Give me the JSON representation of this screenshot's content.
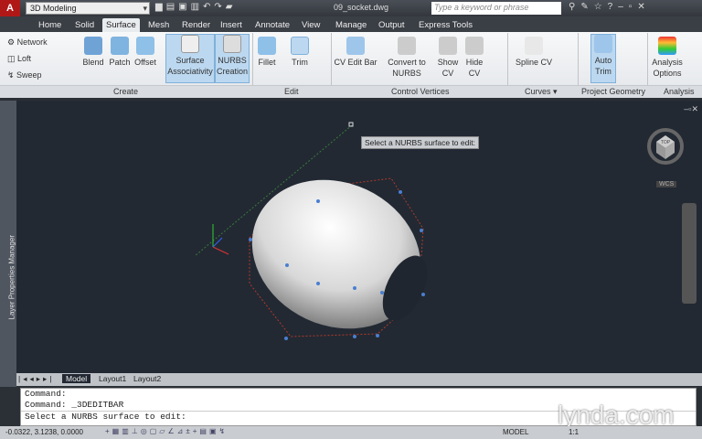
{
  "title": {
    "app_logo": "A",
    "workspace": "3D Modeling",
    "filename": "09_socket.dwg",
    "search_placeholder": "Type a keyword or phrase",
    "help": "?"
  },
  "tabs": [
    "Home",
    "Solid",
    "Surface",
    "Mesh",
    "Render",
    "Insert",
    "Annotate",
    "View",
    "Manage",
    "Output",
    "Express Tools"
  ],
  "active_tab": "Surface",
  "ribbon": {
    "create": {
      "label": "Create",
      "small": [
        "Network",
        "Loft",
        "Sweep"
      ],
      "large": [
        "Blend",
        "Patch",
        "Offset"
      ],
      "surface_assoc": [
        "Surface",
        "Associativity"
      ],
      "nurbs_creation": [
        "NURBS",
        "Creation"
      ]
    },
    "edit": {
      "label": "Edit",
      "fillet": "Fillet",
      "trim": "Trim"
    },
    "control_vertices": {
      "label": "Control Vertices",
      "cv_edit_bar": "CV Edit Bar",
      "convert": [
        "Convert to",
        "NURBS"
      ],
      "show_cv": [
        "Show",
        "CV"
      ],
      "hide_cv": [
        "Hide",
        "CV"
      ]
    },
    "curves": {
      "label": "Curves ▾",
      "spline_cv": "Spline CV"
    },
    "project_geometry": {
      "label": "Project Geometry",
      "auto_trim": [
        "Auto",
        "Trim"
      ]
    },
    "analysis": {
      "label": "Analysis",
      "options": [
        "Analysis",
        "Options"
      ]
    }
  },
  "palette": {
    "layer_manager": "Layer Properties Manager"
  },
  "viewport": {
    "tooltip": "Select a NURBS surface to edit:",
    "viewcube_face": "TOP",
    "wcs": "WCS"
  },
  "layout_tabs": [
    "Model",
    "Layout1",
    "Layout2"
  ],
  "command_lines": [
    "Command:",
    "Command:  _3DEDITBAR",
    "Select a NURBS surface to edit:"
  ],
  "status": {
    "coords": "-0.0322, 3.1238, 0.0000",
    "model": "MODEL",
    "scale": "1:1"
  },
  "watermark": "lynda.com",
  "colors": {
    "accent": "#bcd8f0",
    "viewport": "#222933",
    "app": "#b01818"
  }
}
